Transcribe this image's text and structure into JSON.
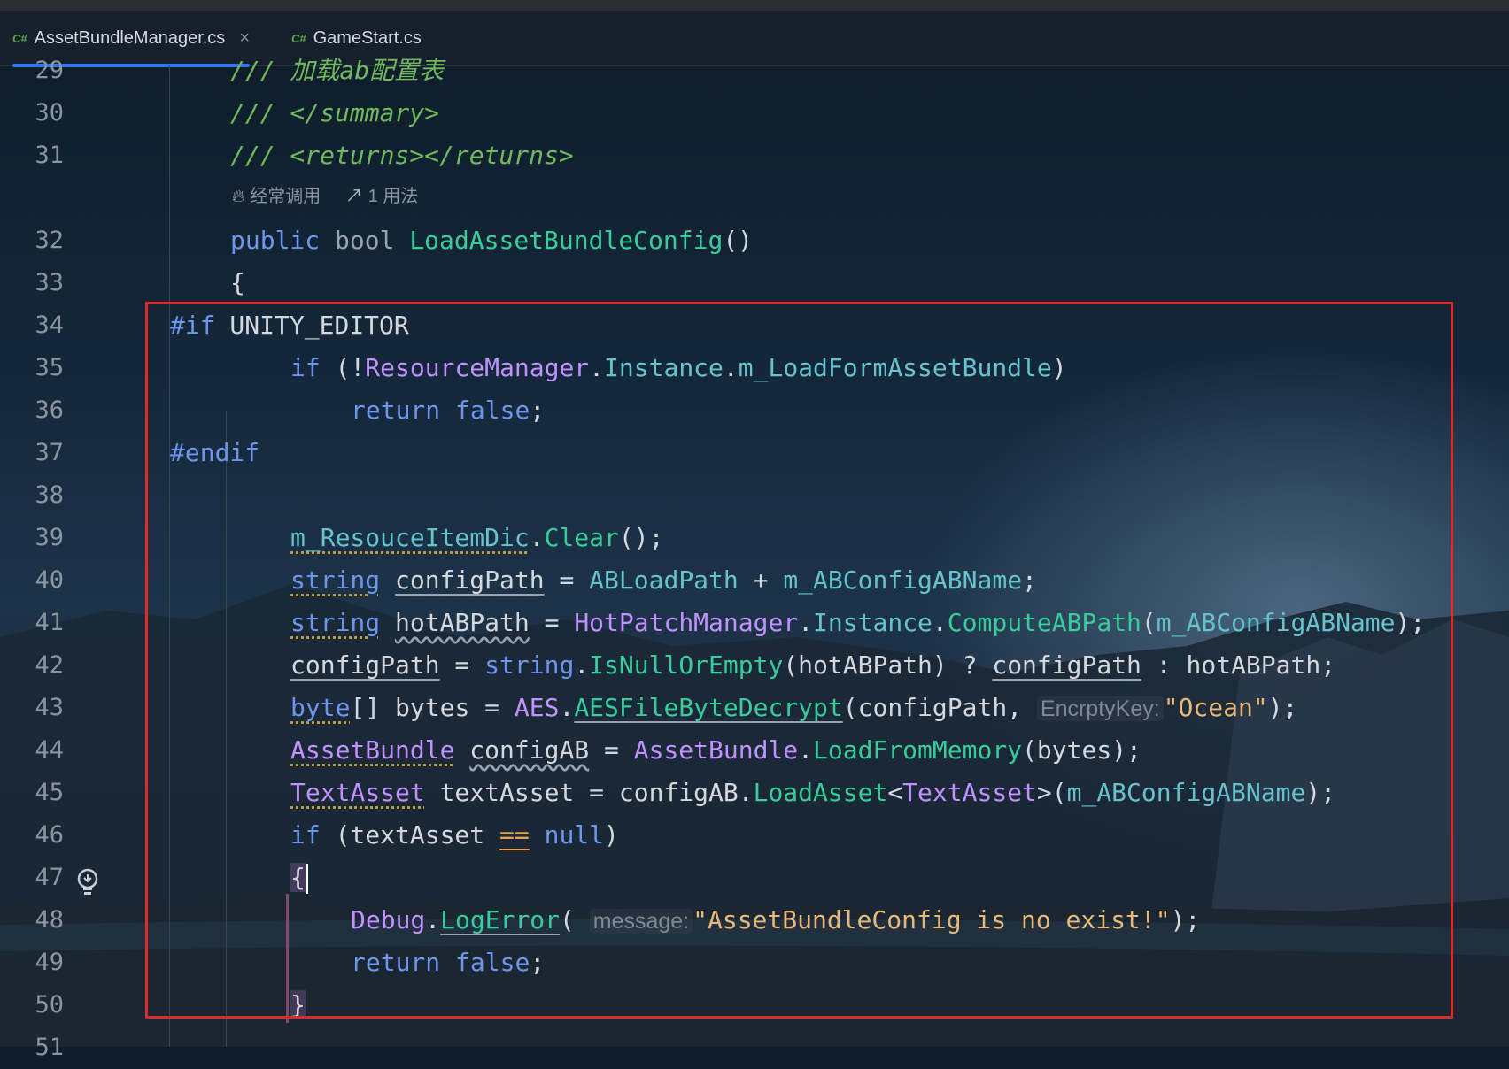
{
  "tabs": [
    {
      "icon": "C#",
      "label": "AssetBundleManager.cs",
      "active": true,
      "close": "×"
    },
    {
      "icon": "C#",
      "label": "GameStart.cs",
      "active": false
    }
  ],
  "hints": {
    "frequent": "经常调用",
    "usage": "1 用法"
  },
  "lines": [
    {
      "n": "29",
      "code": "/// 加载ab配置表"
    },
    {
      "n": "30",
      "code": "/// </summary>"
    },
    {
      "n": "31",
      "code": "/// <returns></returns>"
    },
    {
      "n": "32",
      "code": "public bool LoadAssetBundleConfig()"
    },
    {
      "n": "33",
      "code": "{"
    },
    {
      "n": "34",
      "code": "#if UNITY_EDITOR"
    },
    {
      "n": "35",
      "code": "if (!ResourceManager.Instance.m_LoadFormAssetBundle)"
    },
    {
      "n": "36",
      "code": "return false;"
    },
    {
      "n": "37",
      "code": "#endif"
    },
    {
      "n": "38",
      "code": ""
    },
    {
      "n": "39",
      "code": "m_ResouceItemDic.Clear();"
    },
    {
      "n": "40",
      "code": "string configPath = ABLoadPath + m_ABConfigABName;"
    },
    {
      "n": "41",
      "code": "string hotABPath = HotPatchManager.Instance.ComputeABPath(m_ABConfigABName);"
    },
    {
      "n": "42",
      "code": "configPath = string.IsNullOrEmpty(hotABPath) ? configPath : hotABPath;"
    },
    {
      "n": "43",
      "code": "byte[] bytes = AES.AESFileByteDecrypt(configPath, EncrptyKey: \"Ocean\");"
    },
    {
      "n": "44",
      "code": "AssetBundle configAB = AssetBundle.LoadFromMemory(bytes);"
    },
    {
      "n": "45",
      "code": "TextAsset textAsset = configAB.LoadAsset<TextAsset>(m_ABConfigABName);"
    },
    {
      "n": "46",
      "code": "if (textAsset == null)"
    },
    {
      "n": "47",
      "code": "{"
    },
    {
      "n": "48",
      "code": "Debug.LogError( message: \"AssetBundleConfig is no exist!\");"
    },
    {
      "n": "49",
      "code": "return false;"
    },
    {
      "n": "50",
      "code": "}"
    },
    {
      "n": "51",
      "code": ""
    }
  ],
  "param_hints": {
    "encrypt_key": "EncrptyKey:",
    "message": "message:"
  },
  "strings": {
    "ocean": "\"Ocean\"",
    "error_msg": "\"AssetBundleConfig is no exist!\""
  },
  "colors": {
    "keyword": "#6c95eb",
    "method": "#39cc9b",
    "class": "#c191ff",
    "property": "#66c3cc",
    "string": "#e8b87a",
    "comment": "#6fb85b",
    "selection_box": "#e02a2a",
    "active_tab_underline": "#3574f0"
  },
  "icons": [
    "csharp-file-icon",
    "close-icon",
    "flame-icon",
    "usage-icon",
    "lightbulb-icon"
  ]
}
